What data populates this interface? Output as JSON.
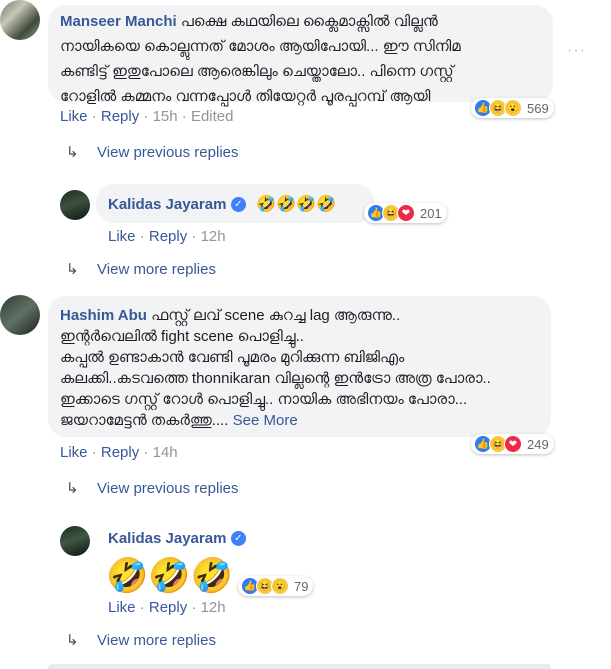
{
  "comments": [
    {
      "author": "Manseer Manchi",
      "lines": [
        "പക്ഷെ കഥയിലെ ക്ലൈമാക്സിൽ വില്ലൻ",
        "നായികയെ കൊല്ലുന്നത് മോശം ആയിപോയി... ഈ സിനിമ",
        "കണ്ടിട്ട് ഇതുപോലെ ആരെങ്കിലും ചെയ്താലോ.. പിന്നെ ഗസ്റ്റ്",
        "റോളിൽ കമ്മനം വന്നപ്പോൾ തിയേറ്റർ പൂരപ്പറമ്പ് ആയി"
      ],
      "reaction_count": "569",
      "actions": {
        "like": "Like",
        "reply": "Reply",
        "time": "15h",
        "edited": "Edited"
      },
      "view_replies": "View previous replies",
      "reply": {
        "author": "Kalidas Jayaram",
        "emoji": "🤣🤣🤣🤣",
        "reaction_count": "201",
        "actions": {
          "like": "Like",
          "reply": "Reply",
          "time": "12h"
        }
      },
      "view_more": "View more replies"
    },
    {
      "author": "Hashim Abu",
      "lines": [
        "ഫസ്റ്റ് ലവ് scene കുറച്ച lag ആരുന്നു..",
        "ഇന്റർവെലിൽ fight scene പൊളിച്ചു..",
        "കപ്പൽ ഉണ്ടാകാൻ വേണ്ടി പൂമരം മുറിക്കുന്ന ബിജിഎം",
        "കലക്കി..കടവത്തെ thonnikaran വില്ലന്റെ ഇൻട്രോ അത്ര പോരാ..",
        "ഇക്കാടെ ഗസ്റ്റ് റോൾ പൊളിച്ചു.. നായിക അഭിനയം പോരാ...",
        "ജയറാമേട്ടൻ തകർത്തു...."
      ],
      "see_more": "See More",
      "reaction_count": "249",
      "actions": {
        "like": "Like",
        "reply": "Reply",
        "time": "14h"
      },
      "view_replies": "View previous replies",
      "reply": {
        "author": "Kalidas Jayaram",
        "emoji": "🤣🤣🤣",
        "reaction_count": "79",
        "actions": {
          "like": "Like",
          "reply": "Reply",
          "time": "12h"
        }
      },
      "view_more": "View more replies"
    }
  ],
  "more_options": "···",
  "separator": "·",
  "icons": {
    "reply_arrow": "↳",
    "like_reaction": "👍",
    "haha_reaction": "😆",
    "wow_reaction": "😮",
    "love_reaction": "❤",
    "verified": "✓"
  }
}
